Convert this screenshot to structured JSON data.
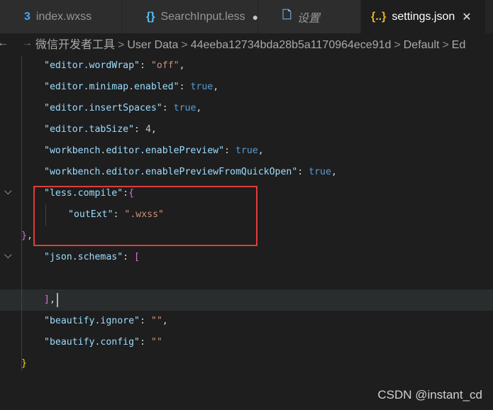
{
  "tabs": [
    {
      "label": "index.wxss",
      "icon": "css-file-icon",
      "glyph": "3",
      "color": "#42a5f5",
      "state": "normal"
    },
    {
      "label": "SearchInput.less",
      "icon": "braces-file-icon",
      "glyph": "{}",
      "color": "#4fc3f7",
      "state": "modified"
    },
    {
      "label": "设置",
      "icon": "document-icon",
      "glyph": "🗋",
      "color": "#7ab1e8",
      "state": "normal"
    },
    {
      "label": "settings.json",
      "icon": "json-file-icon",
      "glyph": "{..}",
      "color": "#e6b422",
      "state": "active"
    }
  ],
  "breadcrumb": {
    "segments": [
      "微信开发者工具",
      "User Data",
      "44eeba12734bda28b5a1170964ece91d",
      "Default",
      "Ed"
    ],
    "separator": ">"
  },
  "code": {
    "lines": [
      {
        "tokens": [
          [
            "k",
            "\"editor.wordWrap\""
          ],
          [
            "p",
            ": "
          ],
          [
            "s",
            "\"off\""
          ],
          [
            "p",
            ","
          ]
        ]
      },
      {
        "tokens": [
          [
            "k",
            "\"editor.minimap.enabled\""
          ],
          [
            "p",
            ": "
          ],
          [
            "b",
            "true"
          ],
          [
            "p",
            ","
          ]
        ]
      },
      {
        "tokens": [
          [
            "k",
            "\"editor.insertSpaces\""
          ],
          [
            "p",
            ": "
          ],
          [
            "b",
            "true"
          ],
          [
            "p",
            ","
          ]
        ]
      },
      {
        "tokens": [
          [
            "k",
            "\"editor.tabSize\""
          ],
          [
            "p",
            ": "
          ],
          [
            "n",
            "4"
          ],
          [
            "p",
            ","
          ]
        ]
      },
      {
        "tokens": [
          [
            "k",
            "\"workbench.editor.enablePreview\""
          ],
          [
            "p",
            ": "
          ],
          [
            "b",
            "true"
          ],
          [
            "p",
            ","
          ]
        ]
      },
      {
        "tokens": [
          [
            "k",
            "\"workbench.editor.enablePreviewFromQuickOpen\""
          ],
          [
            "p",
            ": "
          ],
          [
            "b",
            "true"
          ],
          [
            "p",
            ","
          ]
        ]
      },
      {
        "tokens": [
          [
            "k",
            "\"less.compile\""
          ],
          [
            "p",
            ":"
          ],
          [
            "br2",
            "{"
          ]
        ]
      },
      {
        "tokens": [
          [
            "k",
            "\"outExt\""
          ],
          [
            "p",
            ": "
          ],
          [
            "s",
            "\".wxss\""
          ]
        ]
      },
      {
        "tokens": [
          [
            "br2",
            "}"
          ],
          [
            "p",
            ","
          ]
        ]
      },
      {
        "tokens": [
          [
            "k",
            "\"json.schemas\""
          ],
          [
            "p",
            ": "
          ],
          [
            "br2",
            "["
          ]
        ]
      },
      {
        "tokens": []
      },
      {
        "tokens": [
          [
            "br2",
            "]"
          ],
          [
            "p",
            ","
          ]
        ]
      },
      {
        "tokens": [
          [
            "k",
            "\"beautify.ignore\""
          ],
          [
            "p",
            ": "
          ],
          [
            "s",
            "\"\""
          ],
          [
            "p",
            ","
          ]
        ]
      },
      {
        "tokens": [
          [
            "k",
            "\"beautify.config\""
          ],
          [
            "p",
            ": "
          ],
          [
            "s",
            "\"\""
          ]
        ]
      },
      {
        "tokens": [
          [
            "br1",
            "}"
          ]
        ]
      }
    ],
    "folded_markers": [
      "chevron-down-icon",
      "chevron-down-icon"
    ]
  },
  "watermark": "CSDN @instant_cd"
}
